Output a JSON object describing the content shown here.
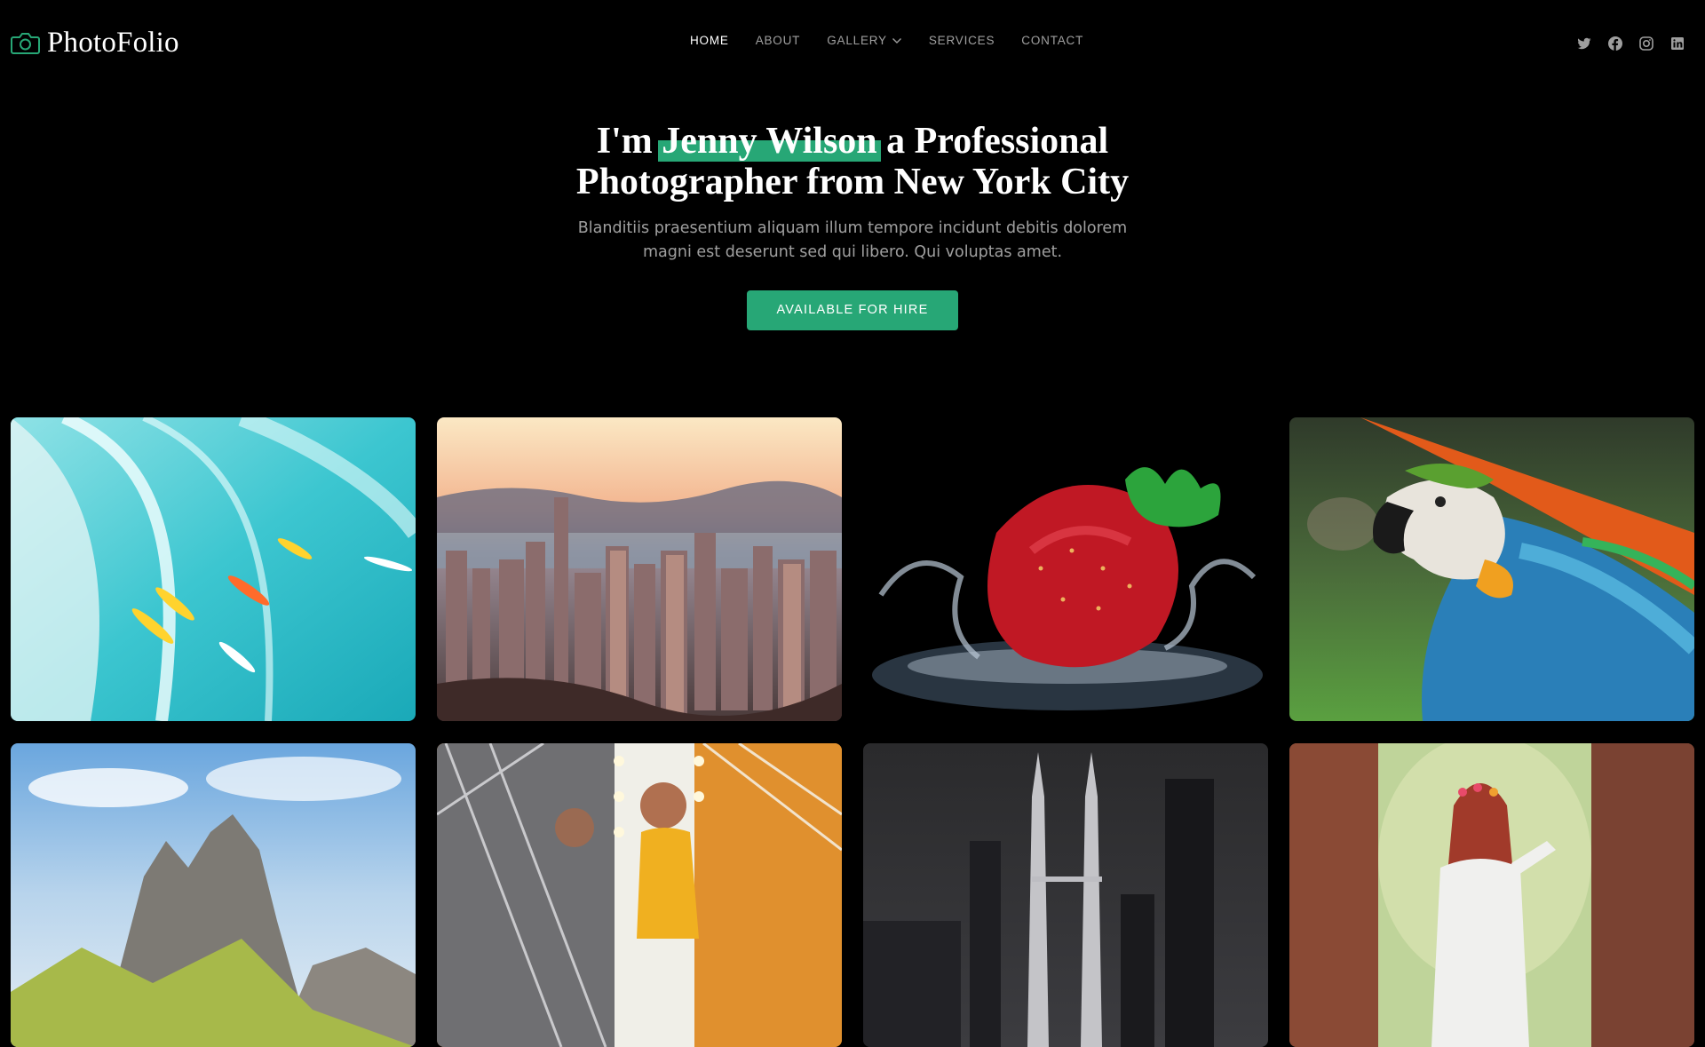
{
  "header": {
    "brand": "PhotoFolio",
    "logo_icon": "camera-icon",
    "nav": [
      {
        "label": "HOME",
        "active": true
      },
      {
        "label": "ABOUT",
        "active": false
      },
      {
        "label": "GALLERY",
        "active": false,
        "has_dropdown": true
      },
      {
        "label": "SERVICES",
        "active": false
      },
      {
        "label": "CONTACT",
        "active": false
      }
    ],
    "social_icons": [
      "twitter-icon",
      "facebook-icon",
      "instagram-icon",
      "linkedin-icon"
    ]
  },
  "hero": {
    "title_prefix": "I'm",
    "title_name": "Jenny Wilson",
    "title_suffix": "a Professional",
    "title_line2": "Photographer from New York City",
    "description": "Blanditiis praesentium aliquam illum tempore incidunt debitis dolorem magni est deserunt sed qui libero. Qui voluptas amet.",
    "cta_label": "AVAILABLE FOR HIRE"
  },
  "gallery": {
    "tiles": [
      "surfers-photo",
      "city-skyline-photo",
      "strawberry-splash-photo",
      "macaw-parrot-photo",
      "mountain-peaks-photo",
      "fashion-model-photo",
      "petronas-towers-photo",
      "woman-in-forest-photo"
    ]
  },
  "colors": {
    "accent": "#27a776",
    "background": "#000000"
  }
}
